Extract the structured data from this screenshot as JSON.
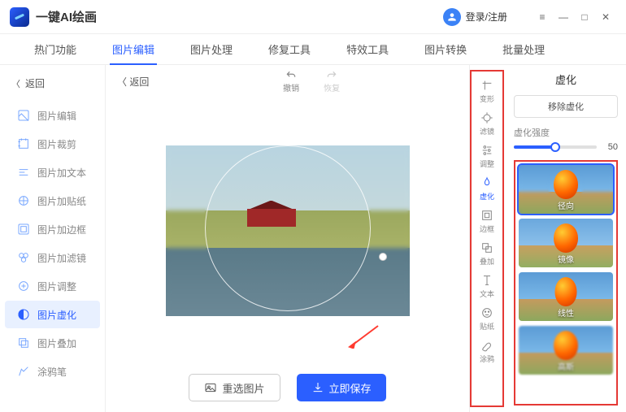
{
  "app_title": "一键AI绘画",
  "login_text": "登录/注册",
  "tabs": [
    "热门功能",
    "图片编辑",
    "图片处理",
    "修复工具",
    "特效工具",
    "图片转换",
    "批量处理"
  ],
  "tabs_active_index": 1,
  "back_label": "返回",
  "sidebar": [
    {
      "label": "图片编辑"
    },
    {
      "label": "图片裁剪"
    },
    {
      "label": "图片加文本"
    },
    {
      "label": "图片加贴纸"
    },
    {
      "label": "图片加边框"
    },
    {
      "label": "图片加滤镜"
    },
    {
      "label": "图片调整"
    },
    {
      "label": "图片虚化"
    },
    {
      "label": "图片叠加"
    },
    {
      "label": "涂鸦笔"
    }
  ],
  "sidebar_active_index": 7,
  "editor": {
    "back": "返回",
    "undo": "撤销",
    "redo": "恢复",
    "reselect": "重选图片",
    "save": "立即保存"
  },
  "tools": [
    "变形",
    "滤镜",
    "调整",
    "虚化",
    "边框",
    "叠加",
    "文本",
    "贴纸",
    "涂鸦"
  ],
  "tools_active_index": 3,
  "panel": {
    "title": "虚化",
    "remove": "移除虚化",
    "slider_label": "虚化强度",
    "slider_value": "50"
  },
  "presets": [
    "径向",
    "镜像",
    "线性",
    "高斯"
  ],
  "presets_selected_index": 0
}
